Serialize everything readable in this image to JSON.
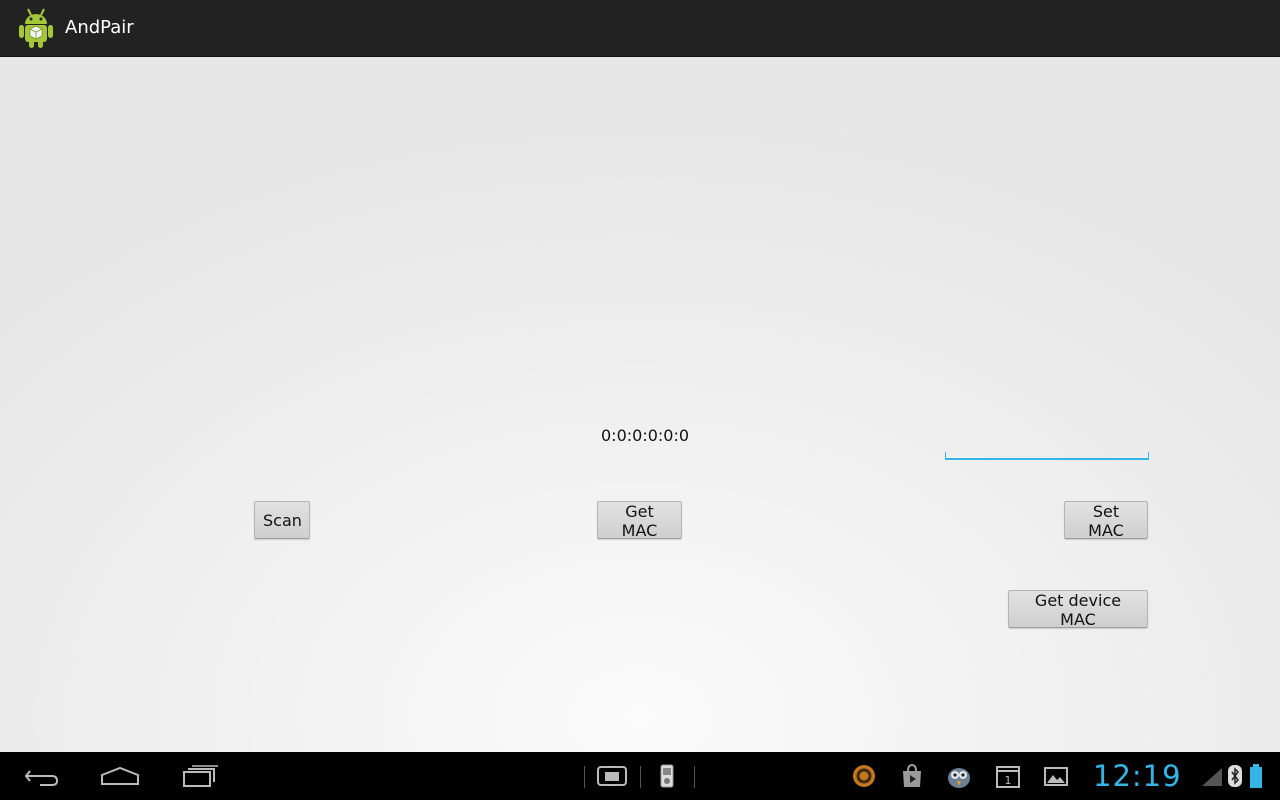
{
  "app": {
    "title": "AndPair",
    "icon": "android-robot-icon"
  },
  "main": {
    "mac_display": "0:0:0:0:0:0",
    "mac_input": {
      "value": "",
      "placeholder": ""
    },
    "buttons": {
      "scan": "Scan",
      "get_mac": "Get MAC",
      "set_mac": "Set MAC",
      "get_device_mac": "Get device MAC"
    }
  },
  "system_bar": {
    "nav": [
      "back-icon",
      "home-icon",
      "recent-apps-icon"
    ],
    "notifications": [
      "screenshot-icon",
      "usb-device-icon"
    ],
    "tray_icons": [
      "app-notification-icon",
      "play-store-icon",
      "bird-app-icon",
      "calendar-icon",
      "gallery-icon"
    ],
    "calendar_day": "1",
    "clock": "12:19",
    "status_icons": [
      "signal-icon",
      "bluetooth-icon",
      "battery-icon"
    ],
    "accent_color": "#33b5e5"
  }
}
